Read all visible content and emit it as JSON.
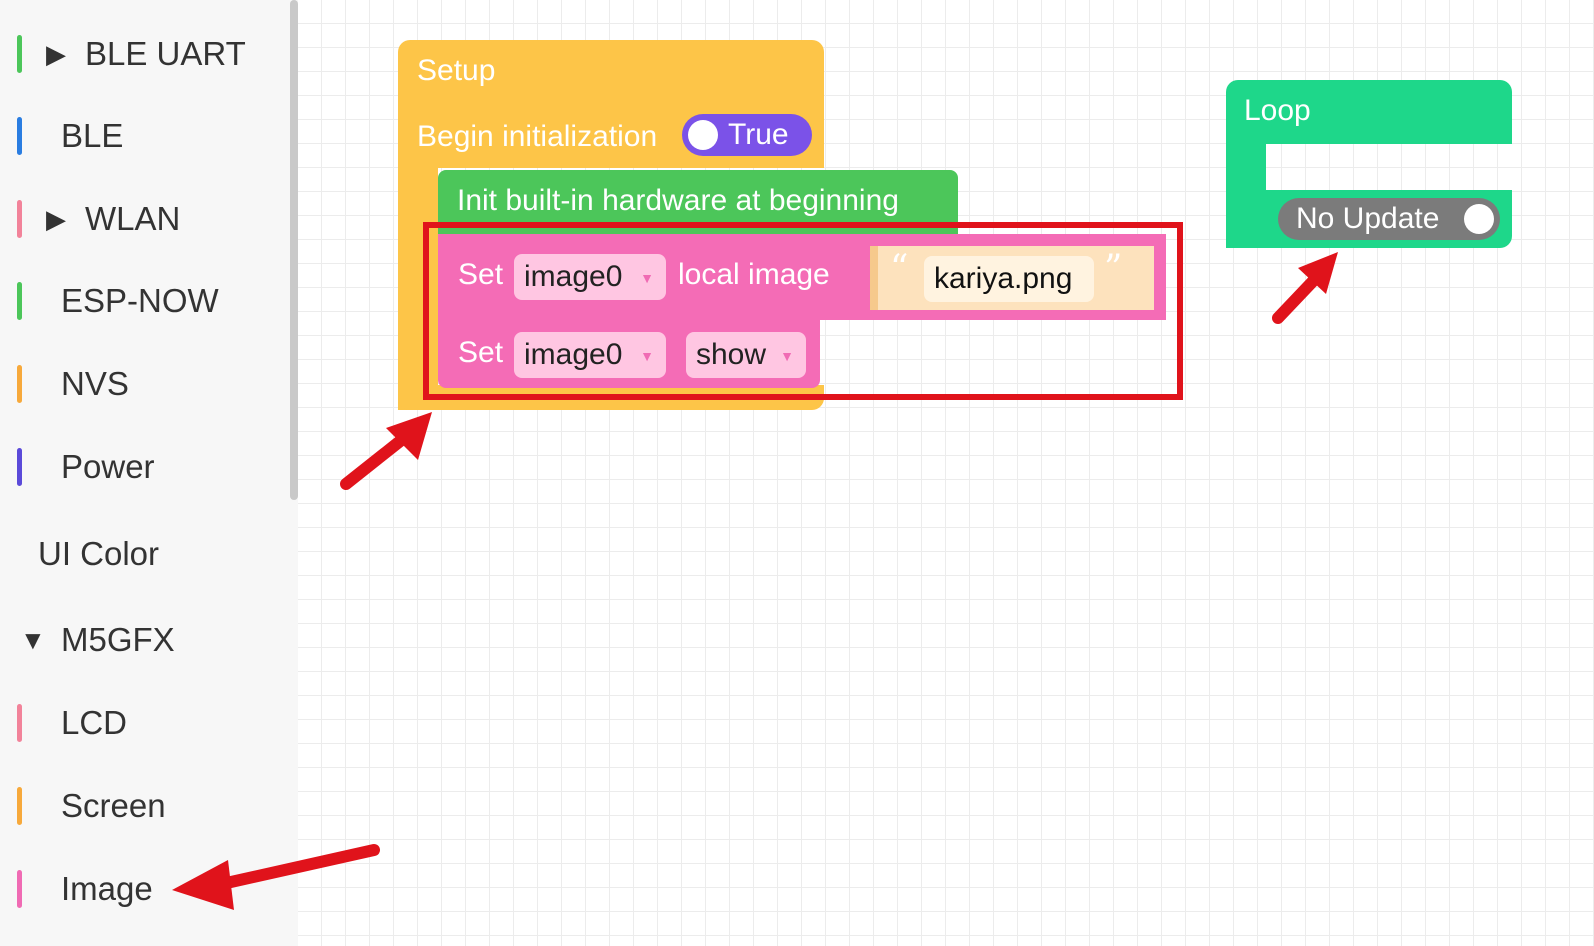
{
  "sidebar": {
    "items": [
      {
        "label": "BLE UART",
        "color": "#4cc65a",
        "expandable": true,
        "expanded": false
      },
      {
        "label": "BLE",
        "color": "#2a7de1",
        "expandable": false
      },
      {
        "label": "WLAN",
        "color": "#f2839a",
        "expandable": true,
        "expanded": false
      },
      {
        "label": "ESP-NOW",
        "color": "#4cc65a",
        "expandable": false
      },
      {
        "label": "NVS",
        "color": "#f7a93b",
        "expandable": false
      },
      {
        "label": "Power",
        "color": "#5b4ad9",
        "expandable": false
      },
      {
        "label": "UI Color",
        "color": "",
        "expandable": false
      },
      {
        "label": "M5GFX",
        "color": "",
        "expandable": true,
        "expanded": true
      },
      {
        "label": "LCD",
        "color": "#f2839a",
        "expandable": false
      },
      {
        "label": "Screen",
        "color": "#f7a93b",
        "expandable": false
      },
      {
        "label": "Image",
        "color": "#f06bb4",
        "expandable": false
      }
    ]
  },
  "icons": {
    "collapsed": "triangle-right-icon",
    "expanded": "triangle-down-icon"
  },
  "workspace": {
    "setup_block": {
      "title": "Setup",
      "begin_label": "Begin initialization",
      "begin_toggle": "True",
      "color": "#fdc548"
    },
    "init_block": {
      "label": "Init built-in hardware at beginning",
      "color": "#4cc65a"
    },
    "set_local_image_block": {
      "set_label": "Set",
      "variable": "image0",
      "action_label": "local image",
      "quote_open": "“",
      "filename": "kariya.png",
      "quote_close": "”",
      "color": "#f46cb6"
    },
    "set_show_block": {
      "set_label": "Set",
      "variable": "image0",
      "action": "show",
      "color": "#f46cb6"
    },
    "loop_block": {
      "title": "Loop",
      "update_toggle": "No Update",
      "color": "#1ed78a"
    }
  },
  "annotations": {
    "highlight_color": "#e0131b",
    "arrow_color": "#e0131b"
  }
}
